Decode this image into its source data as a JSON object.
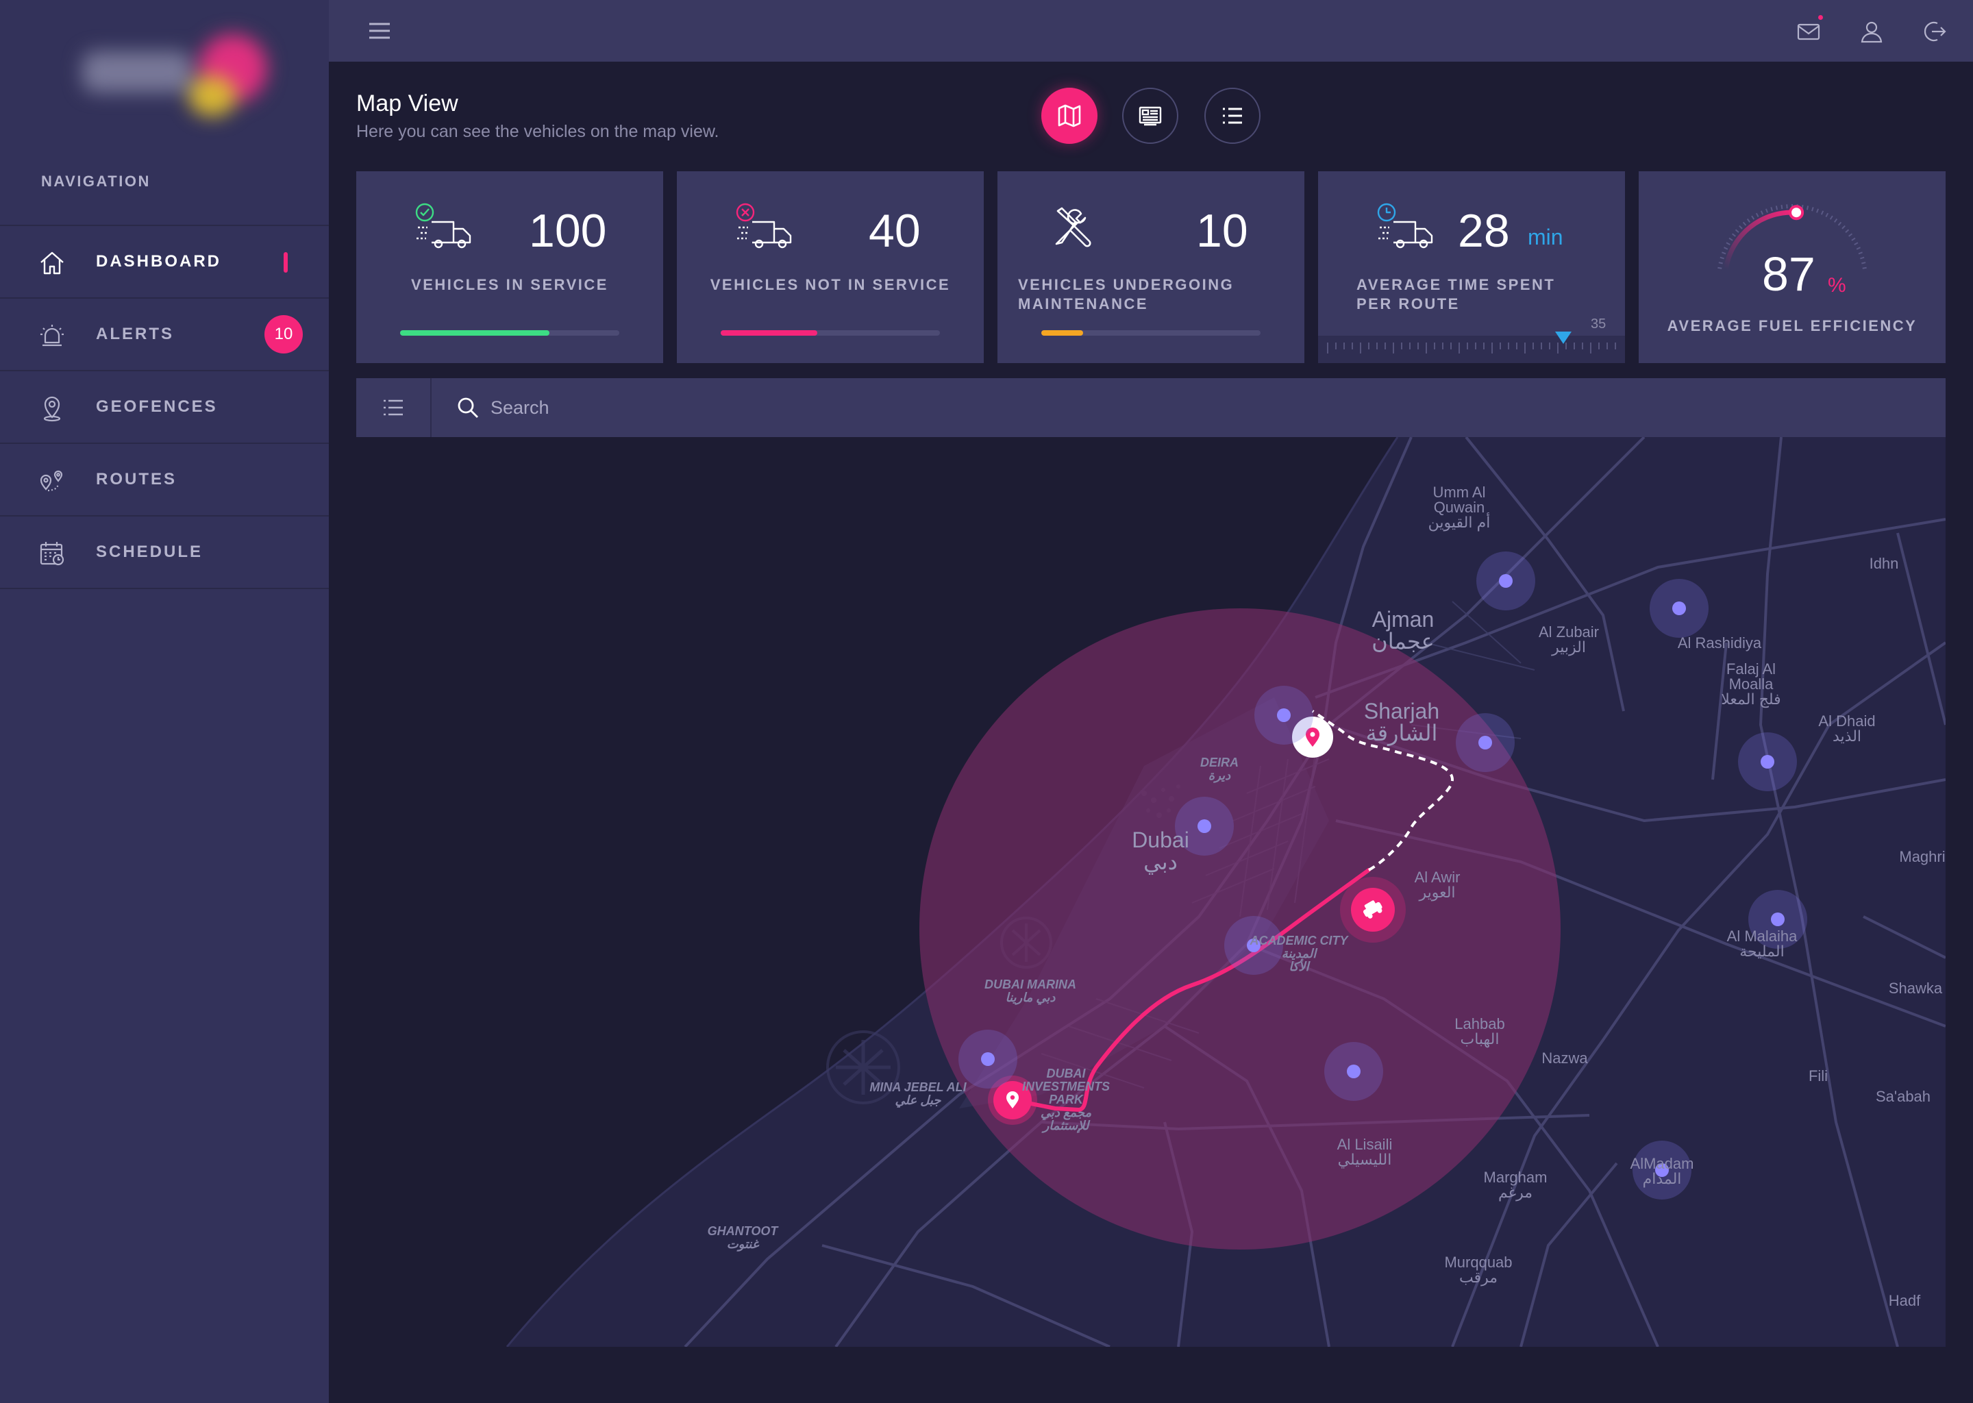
{
  "sidebar": {
    "nav_heading": "NAVIGATION",
    "items": [
      {
        "label": "DASHBOARD",
        "icon": "home-icon",
        "active": true
      },
      {
        "label": "ALERTS",
        "icon": "alarm-bell-icon",
        "badge": "10"
      },
      {
        "label": "GEOFENCES",
        "icon": "map-pin-icon"
      },
      {
        "label": "ROUTES",
        "icon": "route-icon"
      },
      {
        "label": "SCHEDULE",
        "icon": "calendar-icon"
      }
    ]
  },
  "topbar": {
    "icons": [
      "hamburger-menu-icon",
      "mail-icon",
      "user-icon",
      "logout-icon"
    ]
  },
  "header": {
    "title": "Map View",
    "subtitle": "Here you can see the vehicles on the map view.",
    "view_buttons": [
      {
        "icon": "map-icon",
        "active": true
      },
      {
        "icon": "card-list-icon",
        "active": false
      },
      {
        "icon": "list-icon",
        "active": false
      }
    ]
  },
  "stats": [
    {
      "value": "100",
      "label": "VEHICLES IN SERVICE",
      "icon": "truck-check-icon",
      "progress": 0.68,
      "color": "#3ddc84"
    },
    {
      "value": "40",
      "label": "VEHICLES NOT IN SERVICE",
      "icon": "truck-cross-icon",
      "progress": 0.44,
      "color": "#f5257a"
    },
    {
      "value": "10",
      "label_lines": [
        "VEHICLES UNDERGOING",
        "MAINTENANCE"
      ],
      "icon": "tools-icon",
      "progress": 0.19,
      "color": "#f5a623"
    },
    {
      "value": "28",
      "unit": "min",
      "label_lines": [
        "AVERAGE TIME SPENT",
        "PER ROUTE"
      ],
      "icon": "truck-clock-icon",
      "scale_max": "35"
    },
    {
      "value": "87",
      "unit": "%",
      "label": "AVERAGE FUEL EFFICIENCY",
      "gauge": 0.87
    }
  ],
  "search": {
    "placeholder": "Search",
    "value": ""
  },
  "map": {
    "places": [
      {
        "text": "Umm Al\nQuwain\nأم القيوين",
        "style": "normal"
      },
      {
        "text": "Ajman\nعجمان",
        "style": "big"
      },
      {
        "text": "Sharjah\nالشارقة",
        "style": "big"
      },
      {
        "text": "Dubai\nدبي",
        "style": "big"
      },
      {
        "text": "DEIRA\nديرة",
        "style": "it"
      },
      {
        "text": "Al Zubair\nالزبير",
        "style": "normal"
      },
      {
        "text": "Al Rashidiya",
        "style": "normal"
      },
      {
        "text": "Falaj Al\nMoalla\nفلج المعلا",
        "style": "normal"
      },
      {
        "text": "Al Dhaid\nالذيد",
        "style": "normal"
      },
      {
        "text": "Idhn",
        "style": "normal"
      },
      {
        "text": "Maghri",
        "style": "normal"
      },
      {
        "text": "Al Awir\nالعوير",
        "style": "normal"
      },
      {
        "text": "ACADEMIC CITY\nالمدينة\nالأكا",
        "style": "it"
      },
      {
        "text": "Al Malaiha\nالمليحة",
        "style": "normal"
      },
      {
        "text": "Shawka",
        "style": "normal"
      },
      {
        "text": "DUBAI MARINA\nدبي مارينا",
        "style": "it"
      },
      {
        "text": "Lahbab\nالهباب",
        "style": "normal"
      },
      {
        "text": "Nazwa",
        "style": "normal"
      },
      {
        "text": "Fili",
        "style": "normal"
      },
      {
        "text": "Sa'abah",
        "style": "normal"
      },
      {
        "text": "MINA JEBEL ALI\nجبل علي",
        "style": "it"
      },
      {
        "text": "DUBAI\nINVESTMENTS\nPARK\nمجمع دبي\nللإستثمار",
        "style": "it"
      },
      {
        "text": "Al Lisaili\nالليسيلي",
        "style": "normal"
      },
      {
        "text": "AlMadam\nالمدام",
        "style": "normal"
      },
      {
        "text": "Margham\nمرغم",
        "style": "normal"
      },
      {
        "text": "GHANTOOT\nغنتوت",
        "style": "it"
      },
      {
        "text": "Murqquab\nمرقب",
        "style": "normal"
      },
      {
        "text": "Hadf",
        "style": "normal"
      }
    ],
    "colors": {
      "accent": "#f5257a",
      "node": "#8f86ff",
      "land": "#262546",
      "sea": "#1d1c33"
    }
  }
}
